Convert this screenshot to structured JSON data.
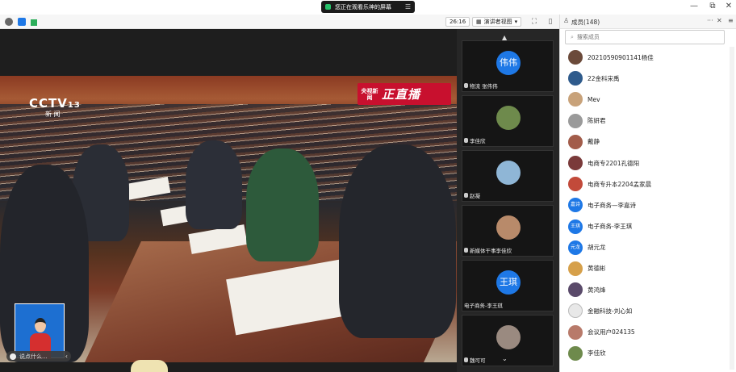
{
  "titlebar": {
    "share_notice": "您正在观看乐神的屏幕",
    "menu_glyph": "☰",
    "controls": [
      "—",
      "⧉",
      "✕"
    ]
  },
  "toolbar": {
    "timer": "26:16",
    "view_mode": "演讲者视图",
    "view_mode_arrow": "▾"
  },
  "video": {
    "channel_logo": "CCTV",
    "channel_number": "13",
    "channel_sub": "新 闻",
    "live_badge_small": "央视新闻",
    "live_badge_big": "正直播",
    "comment_placeholder": "说点什么...",
    "comment_arrow": "‹"
  },
  "strip": {
    "up_arrow": "▲",
    "down_arrow": "⌄",
    "tiles": [
      {
        "name": "物流 张伟伟",
        "avatar_text": "伟伟",
        "avatar_color": "#1e78e6"
      },
      {
        "name": "李佳欣",
        "avatar_text": "",
        "avatar_color": "#6e8a4c"
      },
      {
        "name": "赵凝",
        "avatar_text": "",
        "avatar_color": "#8fb6d6"
      },
      {
        "name": "新媒体干事李佳欣",
        "avatar_text": "",
        "avatar_color": "#b88a6a"
      },
      {
        "name": "电子商务-李王琪",
        "avatar_text": "王琪",
        "avatar_color": "#1e78e6"
      },
      {
        "name": "魏可可",
        "avatar_text": "",
        "avatar_color": "#9a8a80"
      }
    ]
  },
  "panel": {
    "title": "成员(148)",
    "more": "···",
    "close": "✕",
    "search_placeholder": "搜索成员",
    "members": [
      {
        "name": "20210590901141杨佳",
        "avatar_text": "",
        "color": "#6b4a3a"
      },
      {
        "name": "22金科宋禹",
        "avatar_text": "",
        "color": "#2f5b8c"
      },
      {
        "name": "Mev",
        "avatar_text": "",
        "color": "#c8a27a"
      },
      {
        "name": "陈妍君",
        "avatar_text": "",
        "color": "#9a9a9a"
      },
      {
        "name": "戴静",
        "avatar_text": "",
        "color": "#a25c4a"
      },
      {
        "name": "电商专2201孔德阳",
        "avatar_text": "",
        "color": "#7a3a3a"
      },
      {
        "name": "电商专升本2204孟家晨",
        "avatar_text": "",
        "color": "#c24a3a"
      },
      {
        "name": "电子商务—李嘉诗",
        "avatar_text": "嘉诗",
        "color": "#1e78e6"
      },
      {
        "name": "电子商务-李王琪",
        "avatar_text": "王琪",
        "color": "#1e78e6"
      },
      {
        "name": "胡元龙",
        "avatar_text": "元龙",
        "color": "#1e78e6"
      },
      {
        "name": "黄德彬",
        "avatar_text": "",
        "color": "#d6a04a"
      },
      {
        "name": "黄鸿烽",
        "avatar_text": "",
        "color": "#5a4a6a"
      },
      {
        "name": "金融科技-刘心如",
        "avatar_text": "",
        "color": "#e8e8e8"
      },
      {
        "name": "会议用户024135",
        "avatar_text": "",
        "color": "#b87a6a"
      },
      {
        "name": "李佳欣",
        "avatar_text": "",
        "color": "#6e8a4c"
      }
    ]
  }
}
